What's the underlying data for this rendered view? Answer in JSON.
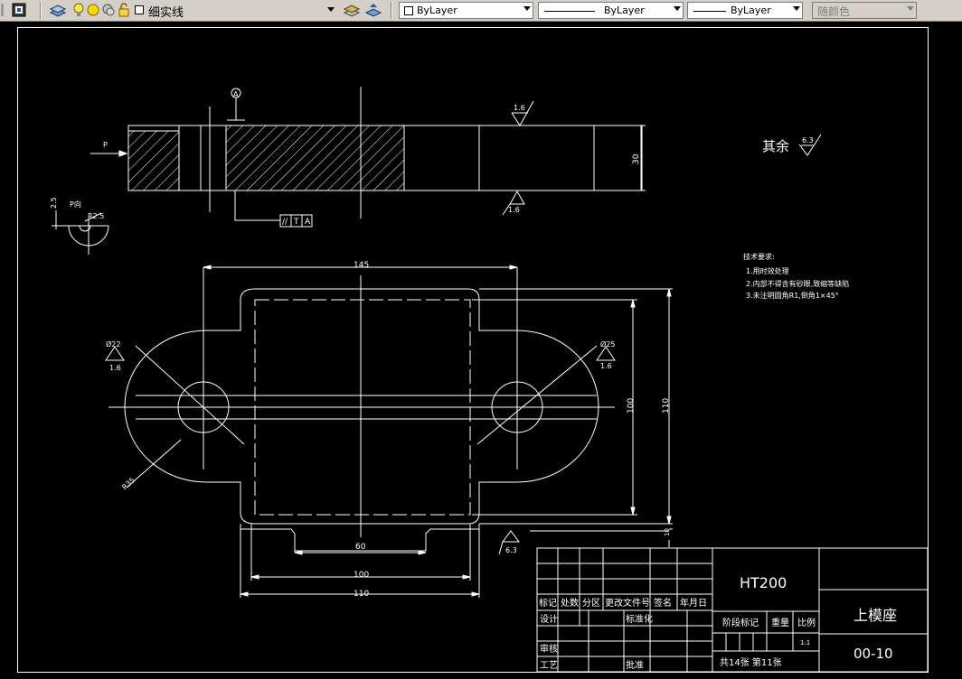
{
  "toolbar": {
    "layer_name": "细实线",
    "color_combo": "ByLayer",
    "linetype_combo": "ByLayer",
    "lineweight_combo": "ByLayer",
    "plotstyle_combo": "随颜色"
  },
  "drawing": {
    "datum_label": "A",
    "view_arrow_label": "P",
    "section_label": "P向",
    "dim_thickness": "30",
    "rough_top": "1.6",
    "rough_bottom": "1.6",
    "tolerance_symbol": "//",
    "tolerance_value": "T",
    "tolerance_datum": "A",
    "detail_dim_2_5": "2.5",
    "detail_radius": "R2.5",
    "other_rough_prefix": "其余",
    "other_rough_value": "6.3",
    "tech_req_title": "技术要求:",
    "tech_req_1": "1.用时效处理",
    "tech_req_2": "2.内部不得含有砂眼,致缩等缺陷",
    "tech_req_3": "3.未注明圆角R1,倒角1×45°",
    "dim_145": "145",
    "dim_100_v": "100",
    "dim_110_v": "110",
    "dim_60": "60",
    "dim_100_h": "100",
    "dim_110_h": "110",
    "dim_phi22": "Ø22",
    "dim_phi25": "Ø25",
    "rough_left_hole": "1.6",
    "rough_right_hole": "1.6",
    "dim_r35": "R35",
    "rough_bottom_edge": "6.3",
    "small_dim_right": "10"
  },
  "title_block": {
    "material": "HT200",
    "part_name": "上模座",
    "drawing_no": "00-10",
    "row_header": [
      "标记",
      "处数",
      "分区",
      "更改文件号",
      "签名",
      "年月日"
    ],
    "design": "设计",
    "standardization": "标准化",
    "stage_mark": "阶段标记",
    "weight": "重量",
    "scale": "比例",
    "scale_value": "1:1",
    "review": "审核",
    "process": "工艺",
    "approve": "批准",
    "sheets": "共14张 第11张"
  }
}
